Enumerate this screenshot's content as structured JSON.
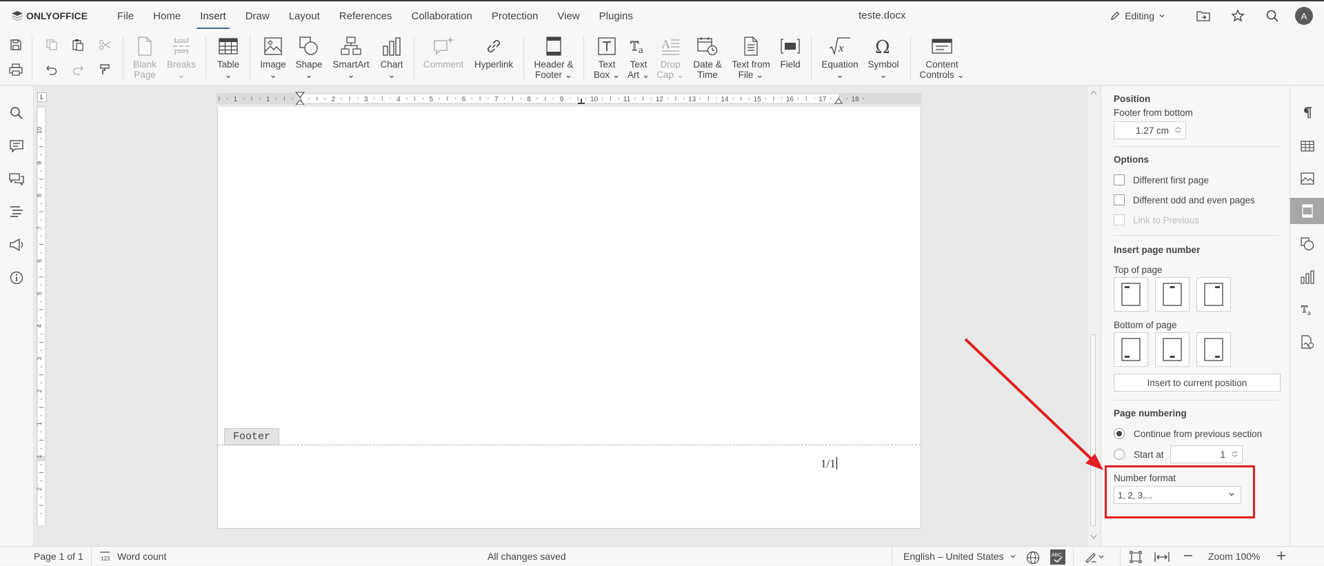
{
  "app": {
    "name": "ONLYOFFICE",
    "doc_title": "teste.docx"
  },
  "menu": {
    "items": [
      "File",
      "Home",
      "Insert",
      "Draw",
      "Layout",
      "References",
      "Collaboration",
      "Protection",
      "View",
      "Plugins"
    ],
    "active": "Insert"
  },
  "header_right": {
    "mode_label": "Editing",
    "avatar_initial": "A"
  },
  "toolbar": {
    "blank_page": [
      "Blank",
      "Page"
    ],
    "breaks": [
      "Breaks",
      ""
    ],
    "table": [
      "Table",
      ""
    ],
    "image": [
      "Image",
      ""
    ],
    "shape": [
      "Shape",
      ""
    ],
    "smartart": [
      "SmartArt",
      ""
    ],
    "chart": [
      "Chart",
      ""
    ],
    "comment": [
      "Comment",
      ""
    ],
    "hyperlink": [
      "Hyperlink",
      ""
    ],
    "header_footer": [
      "Header &",
      "Footer"
    ],
    "text_box": [
      "Text",
      "Box"
    ],
    "text_art": [
      "Text",
      "Art"
    ],
    "drop_cap": [
      "Drop",
      "Cap"
    ],
    "date_time": [
      "Date &",
      "Time"
    ],
    "text_from_file": [
      "Text from",
      "File"
    ],
    "field": [
      "Field",
      ""
    ],
    "equation": [
      "Equation",
      ""
    ],
    "symbol": [
      "Symbol",
      ""
    ],
    "content_controls": [
      "Content",
      "Controls"
    ]
  },
  "ruler": {
    "h_numbers": [
      "2",
      "1",
      "1",
      "1",
      "2",
      "3",
      "4",
      "5",
      "6",
      "7",
      "8",
      "9",
      "10",
      "11",
      "12",
      "13",
      "14",
      "15",
      "16",
      "17",
      "18"
    ],
    "v_numbers": [
      "10",
      "9",
      "8",
      "7",
      "6",
      "5",
      "4",
      "3",
      "2",
      "1",
      "1",
      "2"
    ],
    "corner": "L"
  },
  "document": {
    "footer_tag": "Footer",
    "page_number_text": "1/1"
  },
  "right_panel": {
    "position_heading": "Position",
    "footer_from_bottom_label": "Footer from bottom",
    "footer_from_bottom_value": "1.27 cm",
    "options_heading": "Options",
    "diff_first_page": "Different first page",
    "diff_odd_even": "Different odd and even pages",
    "link_to_previous": "Link to Previous",
    "insert_page_number_heading": "Insert page number",
    "top_of_page": "Top of page",
    "bottom_of_page": "Bottom of page",
    "insert_current_position": "Insert to current position",
    "page_numbering_heading": "Page numbering",
    "continue_prev": "Continue from previous section",
    "start_at_label": "Start at",
    "start_at_value": "1",
    "number_format_label": "Number format",
    "number_format_value": "1, 2, 3,..."
  },
  "status": {
    "page": "Page 1 of 1",
    "word_count": "Word count",
    "saved": "All changes saved",
    "language": "English – United States",
    "zoom": "Zoom 100%"
  },
  "colors": {
    "accent": "#446995",
    "highlight": "#e02020"
  }
}
